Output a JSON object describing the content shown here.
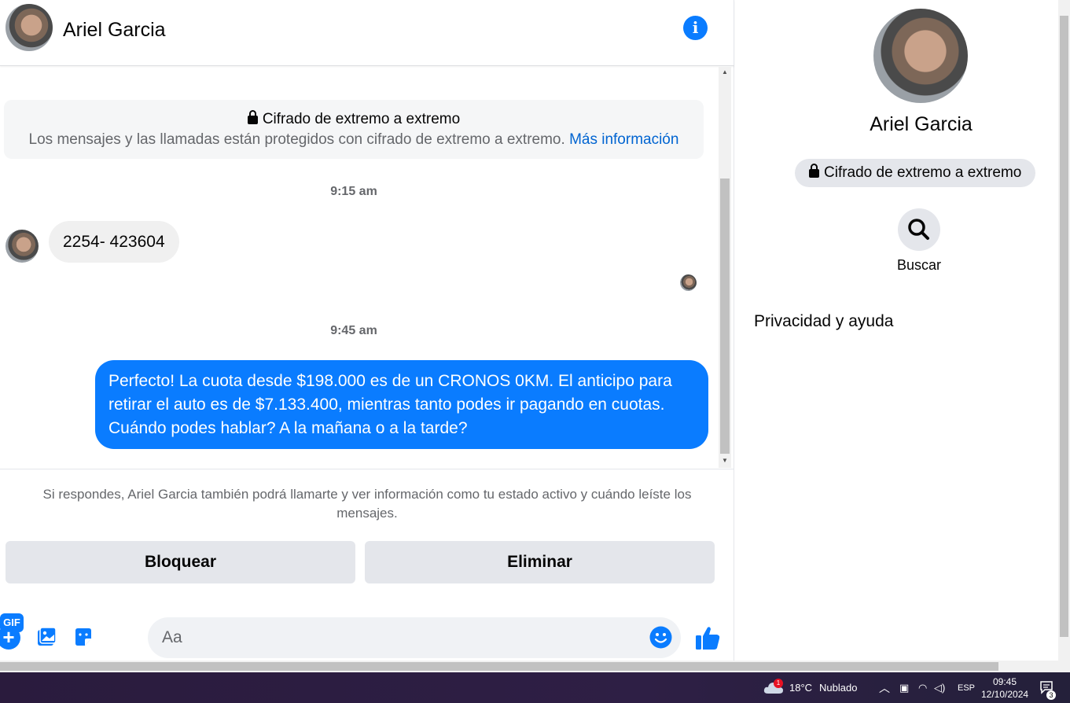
{
  "header": {
    "contact_name": "Ariel Garcia"
  },
  "encryption": {
    "title": "Cifrado de extremo a extremo",
    "description": "Los mensajes y las llamadas están protegidos con cifrado de extremo a extremo.",
    "link": "Más información"
  },
  "messages": [
    {
      "time": "9:15 am",
      "direction": "in",
      "text": "2254- 423604"
    },
    {
      "time": "9:45 am",
      "direction": "out",
      "text": "Perfecto! La cuota desde $198.000 es de un CRONOS 0KM. El anticipo para retirar el auto es de $7.133.400, mientras tanto podes ir pagando en cuotas. Cuándo podes hablar? A la mañana o a la tarde?"
    }
  ],
  "notice": "Si respondes, Ariel Garcia también podrá llamarte y ver información como tu estado activo y cuándo leíste los mensajes.",
  "actions": {
    "block_label": "Bloquear",
    "delete_label": "Eliminar"
  },
  "composer": {
    "placeholder": "Aa",
    "gif_label": "GIF"
  },
  "side": {
    "name": "Ariel Garcia",
    "badge": "Cifrado de extremo a extremo",
    "search_label": "Buscar",
    "section_title": "Privacidad y ayuda"
  },
  "taskbar": {
    "temperature": "18°C",
    "weather": "Nublado",
    "weather_badge": "1",
    "language": "ESP",
    "time": "09:45",
    "date": "12/10/2024",
    "notifications": "3"
  },
  "colors": {
    "accent": "#0a7cff",
    "bubble_in": "#f0f0f0",
    "button_bg": "#e4e6eb"
  }
}
